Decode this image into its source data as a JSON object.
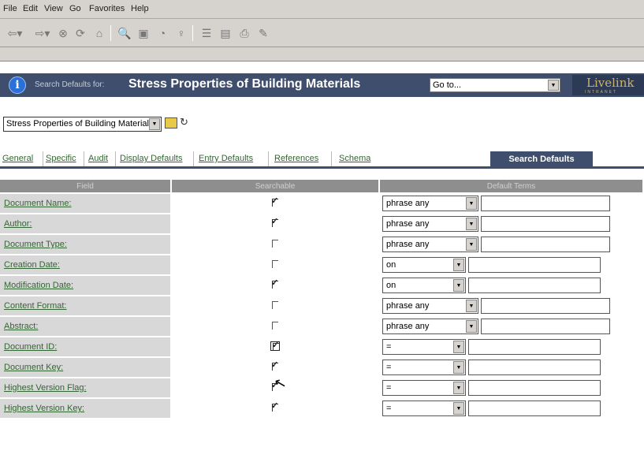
{
  "menu": [
    "File",
    "Edit",
    "View",
    "Go",
    "Favorites",
    "Help"
  ],
  "header": {
    "prefix": "Search Defaults for:",
    "title": "Stress Properties of Building Materials",
    "goto": "Go to...",
    "logo": "Livelink",
    "logo_sub": "INTRANET"
  },
  "crumb": {
    "value": "Stress Properties of Building Materials"
  },
  "tabs": [
    "General",
    "Specific",
    "Audit",
    "Display Defaults",
    "Entry Defaults",
    "References",
    "Schema"
  ],
  "active_tab": "Search Defaults",
  "table": {
    "headers": [
      "Field",
      "Searchable",
      "Default Terms"
    ],
    "rows": [
      {
        "field": "Document Name:",
        "checked": true,
        "op": "phrase any"
      },
      {
        "field": "Author:",
        "checked": true,
        "op": "phrase any"
      },
      {
        "field": "Document Type:",
        "checked": false,
        "op": "phrase any"
      },
      {
        "field": "Creation Date:",
        "checked": false,
        "op": "on"
      },
      {
        "field": "Modification Date:",
        "checked": true,
        "op": "on"
      },
      {
        "field": "Content Format:",
        "checked": false,
        "op": "phrase any"
      },
      {
        "field": "Abstract:",
        "checked": false,
        "op": "phrase any"
      },
      {
        "field": "Document ID:",
        "checked": true,
        "op": "="
      },
      {
        "field": "Document Key:",
        "checked": true,
        "op": "="
      },
      {
        "field": "Highest Version Flag:",
        "checked": true,
        "op": "="
      },
      {
        "field": "Highest Version Key:",
        "checked": true,
        "op": "="
      }
    ]
  }
}
